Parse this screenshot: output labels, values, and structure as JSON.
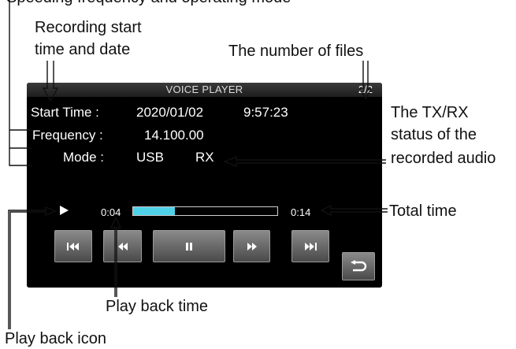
{
  "annotations": {
    "top_cut": "Speeding frequency and operating mode",
    "recording_start_line1": "Recording start",
    "recording_start_line2": "time and date",
    "number_of_files": "The number of files",
    "txrx_line1": "The TX/RX",
    "txrx_line2": "status of the",
    "txrx_line3": "recorded audio",
    "total_time": "Total time",
    "play_back_time": "Play back time",
    "play_back_icon": "Play back icon"
  },
  "screen": {
    "title": "VOICE PLAYER",
    "file_count": "2/2",
    "start_time_label": "Start Time :",
    "start_date": "2020/01/02",
    "start_time": "9:57:23",
    "frequency_label": "Frequency :",
    "frequency": "14.100.00",
    "mode_label": "Mode :",
    "mode": "USB",
    "txrx": "RX",
    "elapsed": "0:04",
    "total": "0:14",
    "progress_fraction": 0.29
  },
  "colors": {
    "screen_bg": "#000000",
    "progress_fill": "#4fd1e8",
    "text": "#ffffff",
    "annotation_text": "#111111"
  },
  "icons": {
    "play_indicator": "play-icon",
    "skip_back": "skip-back-icon",
    "rewind": "rewind-icon",
    "pause": "pause-icon",
    "fast_forward": "fast-forward-icon",
    "skip_forward": "skip-forward-icon",
    "back": "return-icon"
  }
}
